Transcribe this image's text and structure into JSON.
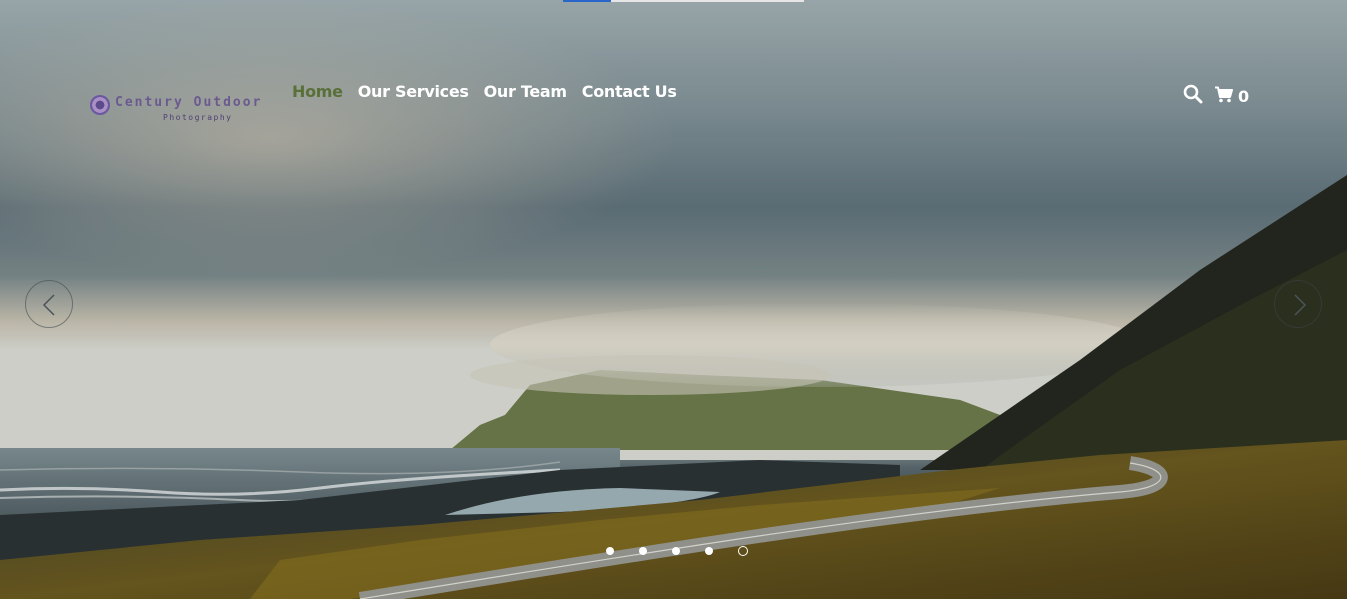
{
  "progress": {
    "fraction": 0.2,
    "color": "#2a66c9"
  },
  "logo": {
    "name": "Century Outdoor",
    "tagline": "Photography"
  },
  "nav": {
    "items": [
      {
        "label": "Home",
        "active": true
      },
      {
        "label": "Our Services",
        "active": false
      },
      {
        "label": "Our Team",
        "active": false
      },
      {
        "label": "Contact Us",
        "active": false
      }
    ],
    "active_color": "#5a7039"
  },
  "header": {
    "search_icon": "search-icon",
    "cart_icon": "cart-icon",
    "cart_count": "0"
  },
  "slider": {
    "prev_icon": "chevron-left-icon",
    "next_icon": "chevron-right-icon",
    "slide_count": 5,
    "active_index": 4
  }
}
